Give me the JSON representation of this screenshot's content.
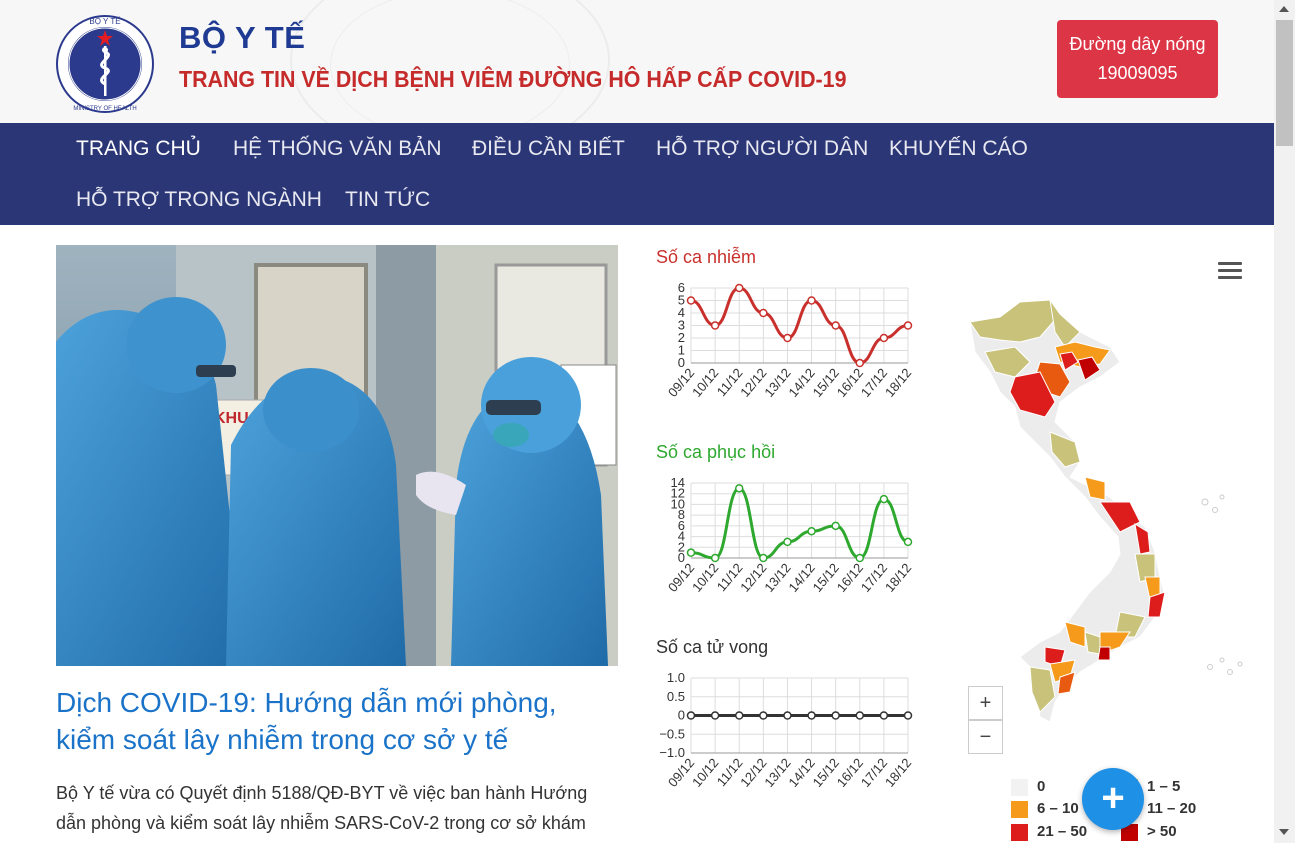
{
  "header": {
    "title": "BỘ Y TẾ",
    "subtitle": "TRANG TIN VỀ DỊCH BỆNH VIÊM ĐƯỜNG HÔ HẤP CẤP COVID-19",
    "logo_text_top": "BỘ Y TẾ",
    "logo_text_bottom": "MINISTRY OF HEALTH",
    "hotline_label": "Đường dây nóng",
    "hotline_number": "19009095",
    "colors": {
      "title": "#1f3a93",
      "subtitle": "#c62b2b",
      "hotline_bg": "#dc3545",
      "nav_bg": "#2b3676"
    }
  },
  "nav": {
    "items": [
      {
        "label": "TRANG CHỦ",
        "active": true
      },
      {
        "label": "HỆ THỐNG VĂN BẢN"
      },
      {
        "label": "ĐIỀU CẦN BIẾT"
      },
      {
        "label": "HỖ TRỢ NGƯỜI DÂN"
      },
      {
        "label": "KHUYẾN CÁO"
      },
      {
        "label": "HỖ TRỢ TRONG NGÀNH"
      },
      {
        "label": "TIN TỨC"
      }
    ]
  },
  "article": {
    "image_sign_text": "KHU VỰC CÁCH LY",
    "title": "Dịch COVID-19: Hướng dẫn mới phòng, kiểm soát lây nhiễm trong cơ sở y tế",
    "excerpt": "Bộ Y tế vừa có Quyết định 5188/QĐ-BYT về việc ban hành Hướng dẫn phòng và kiểm soát lây nhiễm SARS-CoV-2 trong cơ sở khám bệnh,"
  },
  "chart_data": [
    {
      "type": "line",
      "title": "Số ca nhiễm",
      "color": "#c9302c",
      "categories": [
        "09/12",
        "10/12",
        "11/12",
        "12/12",
        "13/12",
        "14/12",
        "15/12",
        "16/12",
        "17/12",
        "18/12"
      ],
      "values": [
        5,
        3,
        6,
        4,
        2,
        5,
        3,
        0,
        2,
        3
      ],
      "ylim": [
        0,
        6
      ],
      "yticks": [
        "0",
        "1",
        "2",
        "3",
        "4",
        "5",
        "6"
      ],
      "grid": true
    },
    {
      "type": "line",
      "title": "Số ca phục hồi",
      "color": "#2ea82e",
      "categories": [
        "09/12",
        "10/12",
        "11/12",
        "12/12",
        "13/12",
        "14/12",
        "15/12",
        "16/12",
        "17/12",
        "18/12"
      ],
      "values": [
        1,
        0,
        13,
        0,
        3,
        5,
        6,
        0,
        11,
        3
      ],
      "ylim": [
        0,
        14
      ],
      "yticks": [
        "0",
        "2",
        "4",
        "6",
        "8",
        "10",
        "12",
        "14"
      ],
      "grid": true
    },
    {
      "type": "line",
      "title": "Số ca tử vong",
      "color": "#333333",
      "categories": [
        "09/12",
        "10/12",
        "11/12",
        "12/12",
        "13/12",
        "14/12",
        "15/12",
        "16/12",
        "17/12",
        "18/12"
      ],
      "values": [
        0,
        0,
        0,
        0,
        0,
        0,
        0,
        0,
        0,
        0
      ],
      "ylim": [
        -1.0,
        1.0
      ],
      "yticks": [
        "−1.0",
        "−0.5",
        "0",
        "0.5",
        "1.0"
      ],
      "grid": true
    }
  ],
  "map": {
    "zoom_in": "+",
    "zoom_out": "−",
    "legend": [
      {
        "label": "0",
        "color": "#f2f2f2"
      },
      {
        "label": "1 – 5",
        "color": "#c8c27a"
      },
      {
        "label": "6 – 10",
        "color": "#f59a1a"
      },
      {
        "label": "11 – 20",
        "color": "#e85a10"
      },
      {
        "label": "21 – 50",
        "color": "#dd1c1c"
      },
      {
        "label": "> 50",
        "color": "#c00000"
      }
    ]
  },
  "fab": {
    "label": "+"
  }
}
